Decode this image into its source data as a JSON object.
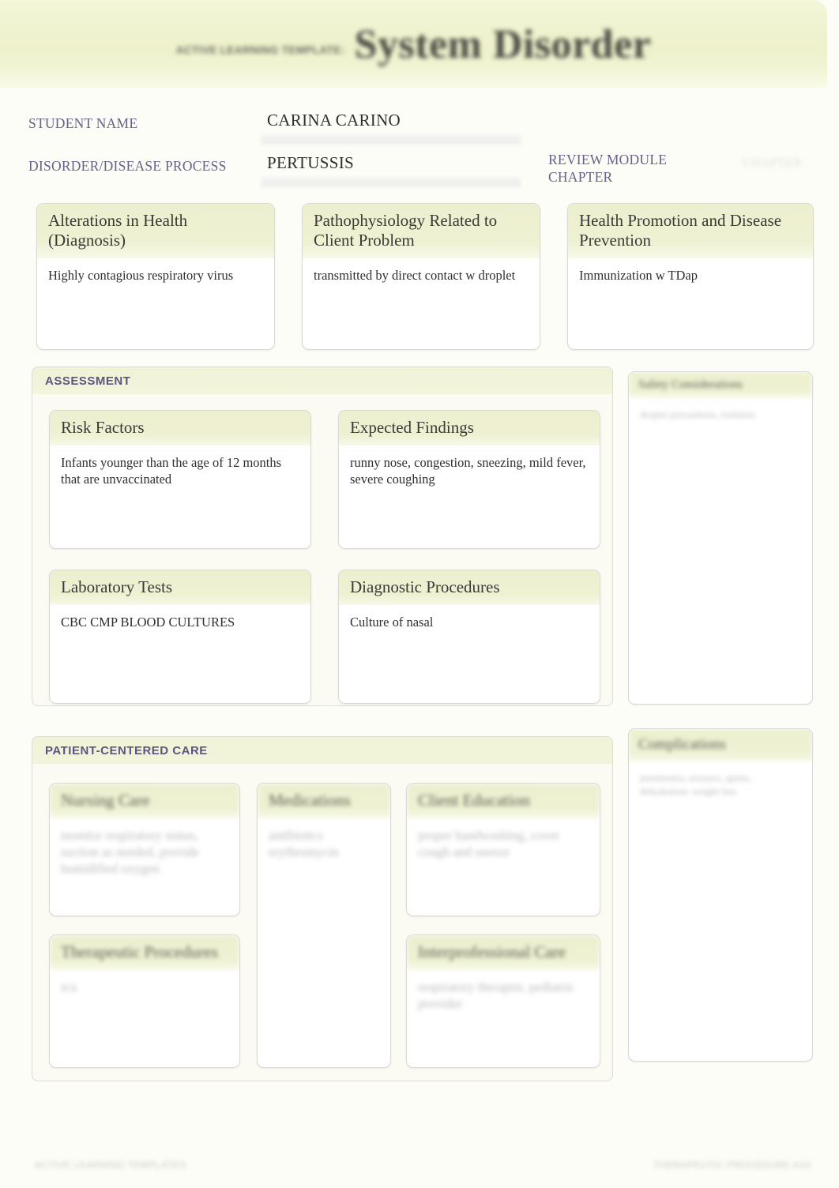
{
  "header": {
    "kicker": "ACTIVE LEARNING TEMPLATE:",
    "title": "System Disorder"
  },
  "meta": {
    "student_name_label": "STUDENT NAME",
    "student_name_value": "CARINA CARINO",
    "disorder_label": "DISORDER/DISEASE PROCESS",
    "disorder_value": "PERTUSSIS",
    "review_module_label": "REVIEW MODULE CHAPTER",
    "review_module_value": "CHAPTER"
  },
  "top_row": [
    {
      "title": "Alterations in Health (Diagnosis)",
      "body": "Highly contagious respiratory virus"
    },
    {
      "title": "Pathophysiology Related to Client Problem",
      "body": "transmitted by direct contact w droplet"
    },
    {
      "title": "Health Promotion and Disease Prevention",
      "body": "Immunization w TDap"
    }
  ],
  "assessment": {
    "section_title": "ASSESSMENT",
    "cards": [
      {
        "title": "Risk Factors",
        "body": "Infants younger than the age of 12 months that are unvaccinated"
      },
      {
        "title": "Expected Findings",
        "body": "runny nose, congestion, sneezing, mild fever, severe coughing"
      },
      {
        "title": "Laboratory Tests",
        "body": " CBC CMP BLOOD CULTURES"
      },
      {
        "title": "Diagnostic Procedures",
        "body": " Culture of nasal"
      }
    ]
  },
  "patient_centered_care": {
    "section_title": "PATIENT-CENTERED CARE",
    "cards": [
      {
        "title": "Nursing Care",
        "body": "monitor respiratory status, suction as needed, provide humidified oxygen"
      },
      {
        "title": "Medications",
        "body": "antibiotics erythromycin"
      },
      {
        "title": "Client Education",
        "body": "proper handwashing, cover cough and sneeze"
      },
      {
        "title": "Therapeutic Procedures",
        "body": "n/a"
      },
      {
        "title": "Interprofessional Care",
        "body": "respiratory therapist, pediatric provider"
      }
    ]
  },
  "right_column": {
    "safety": {
      "title": "Safety Considerations",
      "body": "droplet precautions, isolation"
    },
    "complications": {
      "title": "Complications",
      "body": "pneumonia, seizures, apnea, dehydration, weight loss"
    }
  },
  "footer": {
    "left": "ACTIVE LEARNING TEMPLATES",
    "right": "THERAPEUTIC PROCEDURE   A10"
  },
  "colors": {
    "band_green": "#eef1cb",
    "accent_purple": "#5f5480",
    "label_purple": "#6a5f87",
    "page_background": "#fdfdf7"
  }
}
